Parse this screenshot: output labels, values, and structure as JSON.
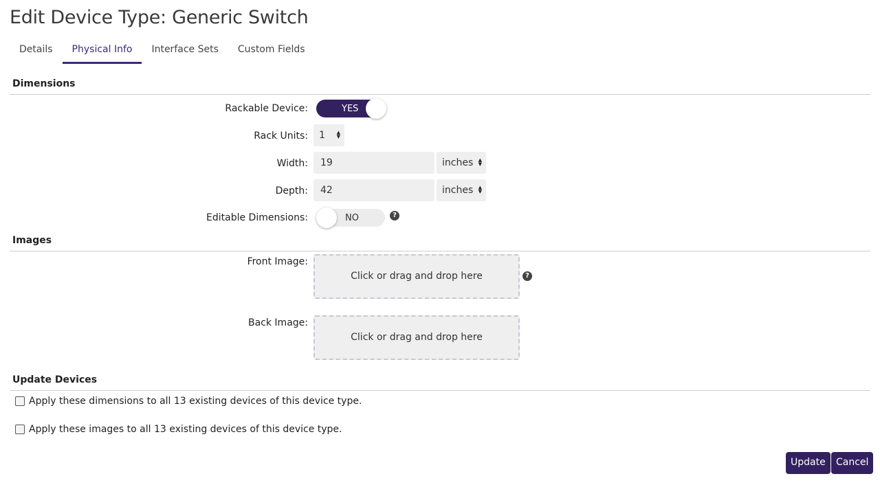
{
  "page": {
    "title": "Edit Device Type: Generic Switch"
  },
  "tabs": [
    {
      "label": "Details"
    },
    {
      "label": "Physical Info"
    },
    {
      "label": "Interface Sets"
    },
    {
      "label": "Custom Fields"
    }
  ],
  "dimensions": {
    "heading": "Dimensions",
    "rackable": {
      "label": "Rackable Device:",
      "toggle_text": "YES"
    },
    "rack_units": {
      "label": "Rack Units:",
      "value": "1"
    },
    "width": {
      "label": "Width:",
      "value": "19",
      "unit": "inches"
    },
    "depth": {
      "label": "Depth:",
      "value": "42",
      "unit": "inches"
    },
    "editable": {
      "label": "Editable Dimensions:",
      "toggle_text": "NO"
    },
    "help_glyph": "?"
  },
  "images": {
    "heading": "Images",
    "front": {
      "label": "Front Image:",
      "drop_text": "Click or drag and drop here"
    },
    "back": {
      "label": "Back Image:",
      "drop_text": "Click or drag and drop here"
    },
    "help_glyph": "?"
  },
  "update_devices": {
    "heading": "Update Devices",
    "apply_dimensions": "Apply these dimensions to all 13 existing devices of this device type.",
    "apply_images": "Apply these images to all 13 existing devices of this device type."
  },
  "buttons": {
    "update": "Update",
    "cancel": "Cancel"
  },
  "colors": {
    "accent": "#33215f",
    "field_bg": "#efefef"
  }
}
